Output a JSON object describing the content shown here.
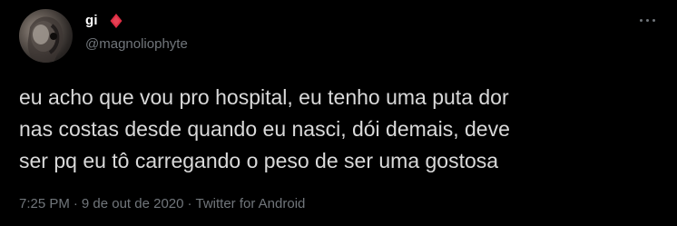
{
  "author": {
    "display_name": "gi",
    "handle": "@magnoliophyte",
    "badge_icon": "red-diamond-icon",
    "badge_color": "#dd2e44"
  },
  "more_icon": "more-horizontal-icon",
  "tweet": {
    "text": "eu acho que vou pro hospital, eu tenho uma puta dor\nnas costas desde quando eu nasci, dói demais, deve\nser pq eu tô carregando o peso de ser uma gostosa"
  },
  "meta": {
    "time": "7:25 PM",
    "separator": "·",
    "date": "9 de out de 2020",
    "source": "Twitter for Android"
  },
  "colors": {
    "background": "#000000",
    "text": "#d9d9d9",
    "secondary": "#71767b"
  }
}
